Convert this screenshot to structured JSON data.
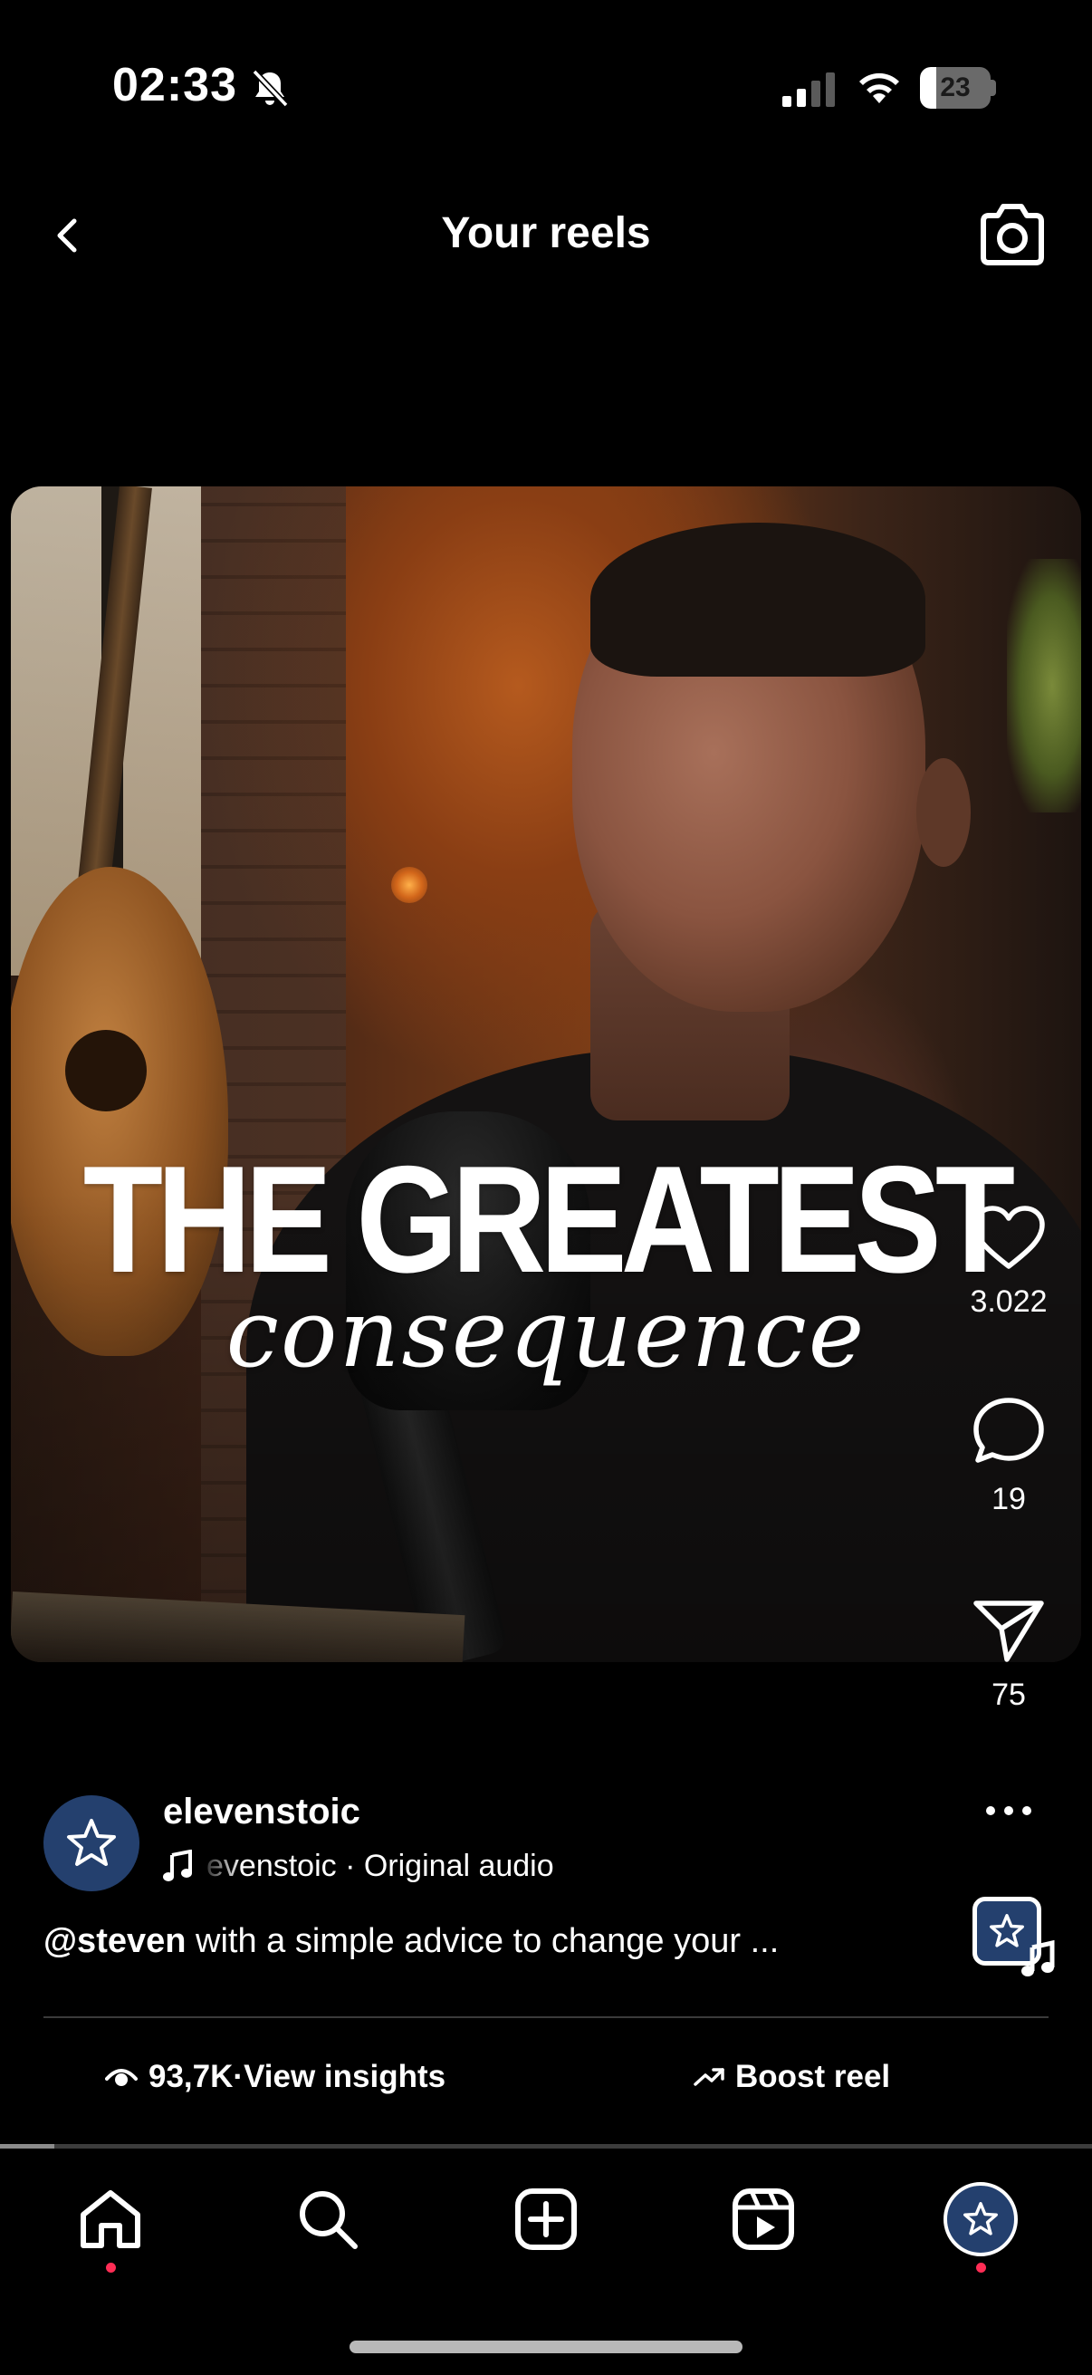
{
  "status_bar": {
    "time": "02:33",
    "battery_percent": "23",
    "battery_level": 0.23,
    "silent_mode": true
  },
  "header": {
    "title": "Your reels",
    "back_icon": "chevron-left-icon",
    "camera_icon": "camera-icon"
  },
  "video": {
    "overlay_title": "THE GREATEST",
    "overlay_subtitle": "consequence"
  },
  "actions": {
    "likes": "3.022",
    "comments": "19",
    "shares": "75"
  },
  "post": {
    "username": "elevenstoic",
    "audio_label": "evenstoic · Original audio",
    "caption_mention": "@steven",
    "caption_text": " with a simple advice to change your ..."
  },
  "insights": {
    "views": "93,7K",
    "separator": " · ",
    "view_insights_label": "View insights",
    "boost_label": "Boost reel"
  },
  "playback": {
    "progress": 0.05
  },
  "tab_bar": {
    "items": [
      "home",
      "search",
      "create",
      "reels",
      "profile"
    ]
  },
  "colors": {
    "background": "#000000",
    "avatar_blue": "#24406e",
    "notification_dot": "#ff2d55"
  }
}
